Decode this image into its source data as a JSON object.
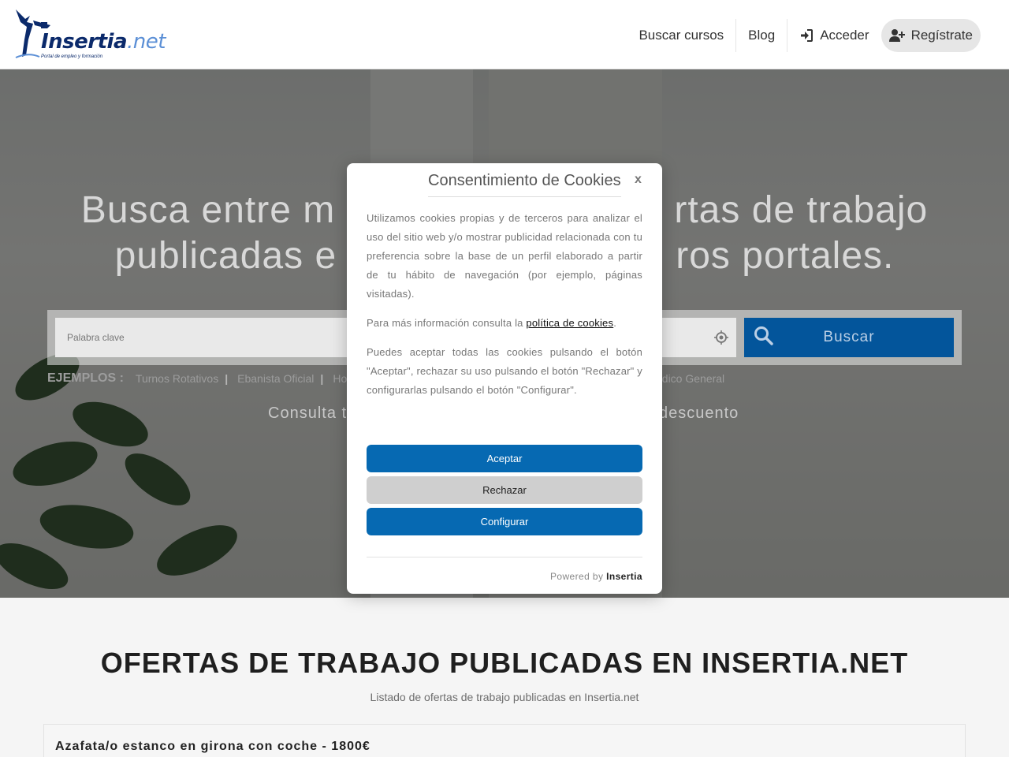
{
  "header": {
    "logo_text_main": "Insertia",
    "logo_text_ext": ".net",
    "logo_tagline": "Portal de empleo y formación",
    "nav": {
      "courses": "Buscar cursos",
      "blog": "Blog",
      "login": "Acceder",
      "register": "Regístrate"
    }
  },
  "hero": {
    "title_line1": "Busca entre m                              rtas de trabajo",
    "title_line2": "publicadas e                              ros portales.",
    "search_placeholder": "Palabra clave",
    "search_button": "Buscar",
    "examples_label": "EJEMPLOS :",
    "examples": [
      "Turnos Rotativos",
      "Ebanista Oficial",
      "Ho"
    ],
    "example_visible_right": "edico General",
    "promo_left": "Consulta t",
    "promo_right": "descuento"
  },
  "modal": {
    "title": "Consentimiento de Cookies",
    "close": "x",
    "paragraph1": "Utilizamos cookies propias y de terceros para analizar el uso del sitio web y/o mostrar publicidad relacionada con tu preferencia sobre la base de un perfil elaborado a partir de tu hábito de navegación (por ejemplo, páginas visitadas).",
    "paragraph2_prefix": "Para más información consulta la ",
    "paragraph2_link": "política de cookies",
    "paragraph2_suffix": ".",
    "paragraph3": "Puedes aceptar todas las cookies pulsando el botón \"Aceptar\", rechazar su uso pulsando el botón \"Rechazar\" y configurarlas pulsando el botón \"Configurar\".",
    "accept": "Aceptar",
    "reject": "Rechazar",
    "configure": "Configurar",
    "powered_prefix": "Powered by ",
    "powered_brand": "Insertia"
  },
  "section": {
    "title": "OFERTAS DE TRABAJO PUBLICADAS EN INSERTIA.NET",
    "subtitle": "Listado de ofertas de trabajo publicadas en Insertia.net",
    "first_job": "Azafata/o estanco en girona con coche - 1800€"
  },
  "colors": {
    "primary": "#0669b2",
    "search_button": "#03559b",
    "brand_dark": "#0b2a6b"
  }
}
